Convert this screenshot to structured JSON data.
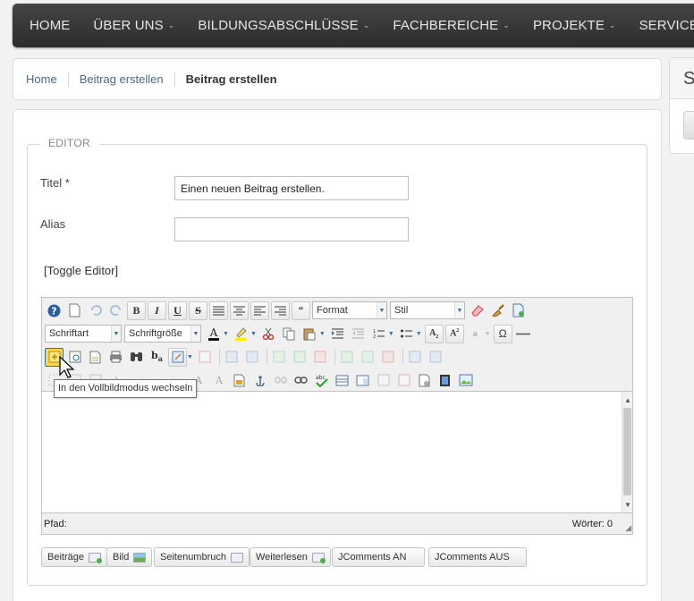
{
  "nav": {
    "items": [
      {
        "label": "HOME",
        "caret": false
      },
      {
        "label": "ÜBER UNS",
        "caret": true
      },
      {
        "label": "BILDUNGSABSCHLÜSSE",
        "caret": true
      },
      {
        "label": "FACHBEREICHE",
        "caret": true
      },
      {
        "label": "PROJEKTE",
        "caret": true
      },
      {
        "label": "SERVICE",
        "caret": false
      }
    ],
    "caret_glyph": "⌄"
  },
  "breadcrumb": [
    "Home",
    "Beitrag erstellen",
    "Beitrag erstellen"
  ],
  "side_panel": {
    "heading": "S"
  },
  "form": {
    "legend": "EDITOR",
    "title_label": "Titel *",
    "title_value": "Einen neuen Beitrag erstellen.",
    "alias_label": "Alias",
    "alias_value": "",
    "toggle_label": "[Toggle Editor]"
  },
  "editor": {
    "format_label": "Format",
    "style_label": "Stil",
    "font_label": "Schriftart",
    "size_label": "Schriftgröße",
    "path_label": "Pfad:",
    "words_label": "Wörter: 0",
    "tooltip": "In den Vollbildmodus wechseln"
  },
  "buttons": [
    {
      "label": "Beiträge",
      "icon": "article-icon"
    },
    {
      "label": "Bild",
      "icon": "image-icon"
    },
    {
      "label": "Seitenumbruch",
      "icon": "pagebreak-icon"
    },
    {
      "label": "Weiterlesen",
      "icon": "readmore-icon"
    },
    {
      "label": "JComments AN",
      "icon": ""
    },
    {
      "label": "JComments AUS",
      "icon": ""
    }
  ],
  "colors": {
    "nav_bg": "#333333",
    "link": "#4a6a8a"
  }
}
